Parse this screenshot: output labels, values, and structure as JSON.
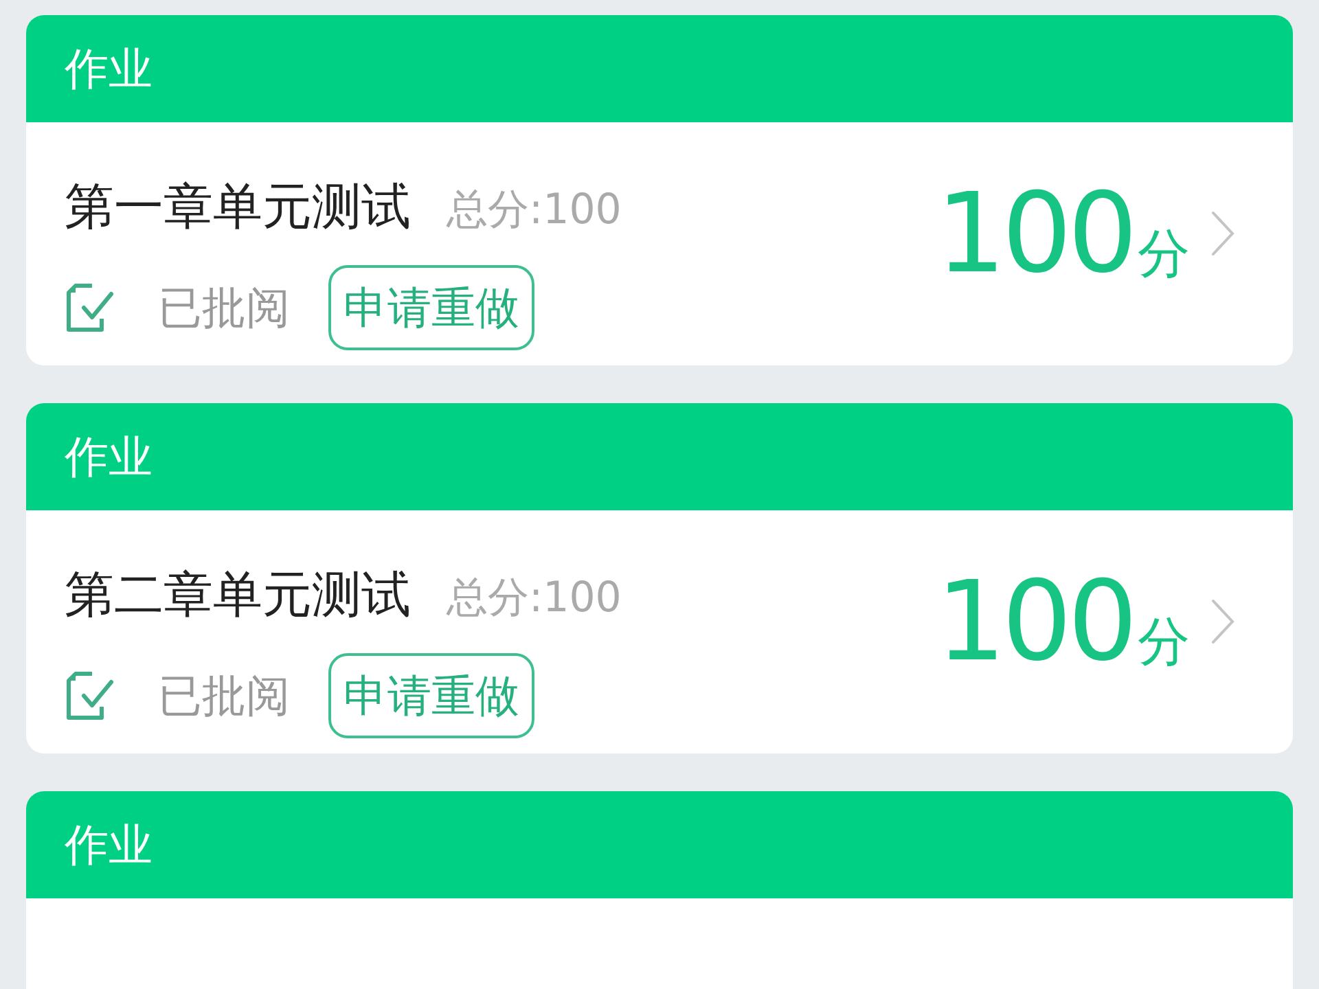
{
  "cards": [
    {
      "header": "作业",
      "title": "第一章单元测试",
      "total": "总分:100",
      "status": "已批阅",
      "action": "申请重做",
      "score": "100",
      "score_unit": "分"
    },
    {
      "header": "作业",
      "title": "第二章单元测试",
      "total": "总分:100",
      "status": "已批阅",
      "action": "申请重做",
      "score": "100",
      "score_unit": "分"
    },
    {
      "header": "作业"
    }
  ]
}
